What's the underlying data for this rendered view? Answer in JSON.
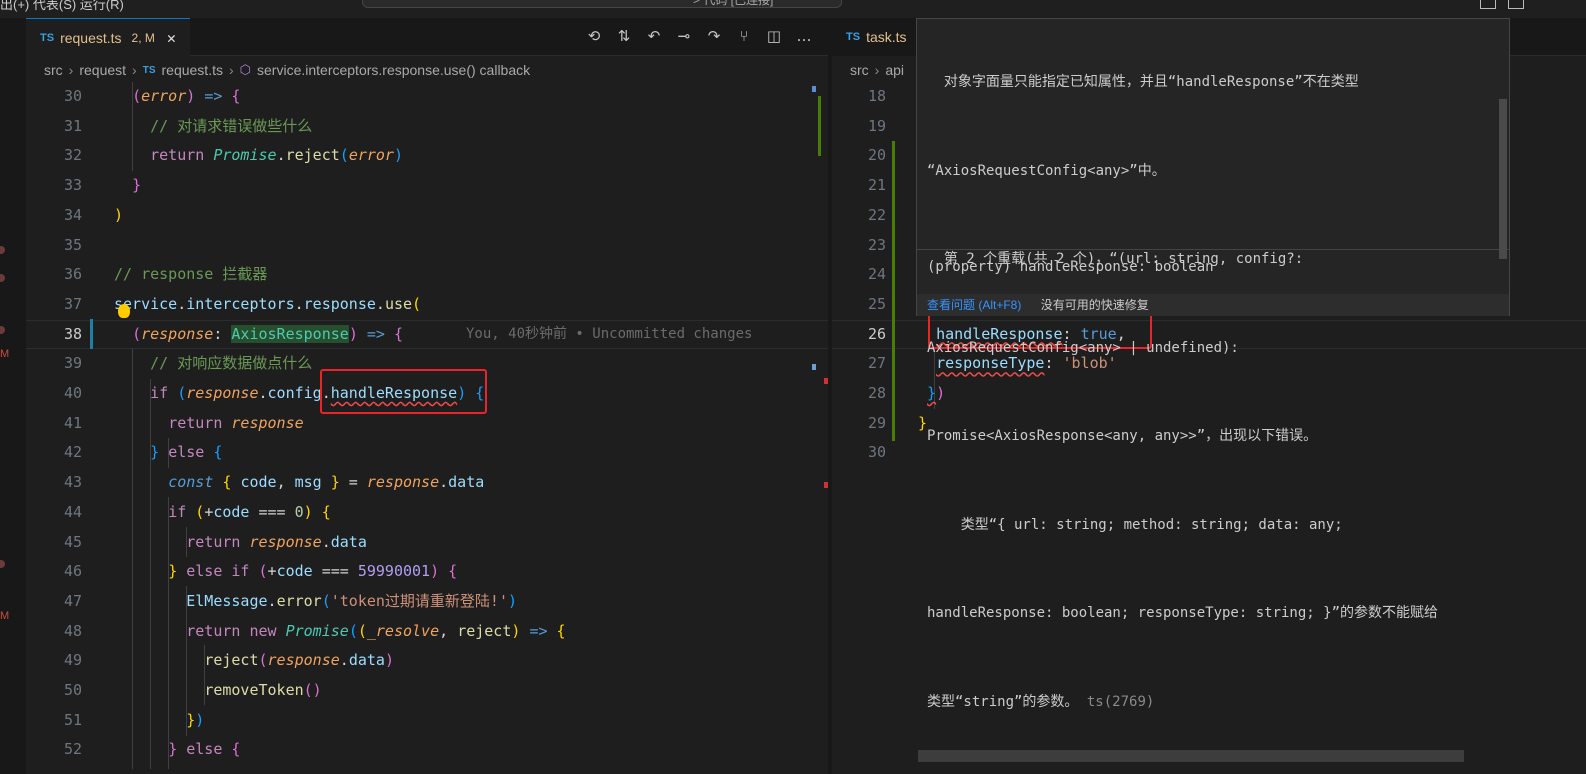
{
  "topbar": {
    "menu_text": "出(+) 代表(S) 运行(R)",
    "search_text": "> 代码 [已连接]"
  },
  "left": {
    "tab": {
      "lang": "TS",
      "filename": "request.ts",
      "badge": "2, M",
      "close": "✕"
    },
    "breadcrumb": [
      "src",
      "request",
      "request.ts",
      "service.interceptors.response.use() callback"
    ],
    "breadcrumb_lang": "TS",
    "toolbar_icons": [
      "history-icon",
      "git-compare-icon",
      "go-back-icon",
      "git-commit-icon",
      "go-forward-icon",
      "source-control-icon",
      "split-editor-icon",
      "more-actions-icon"
    ],
    "blame": "You, 40秒钟前 • Uncommitted changes",
    "line_numbers": [
      "30",
      "31",
      "32",
      "33",
      "34",
      "35",
      "36",
      "37",
      "38",
      "39",
      "40",
      "41",
      "42",
      "43",
      "44",
      "45",
      "46",
      "47",
      "48",
      "49",
      "50",
      "51",
      "52"
    ],
    "l31": "// 对请求错误做些什么",
    "l36": "// response 拦截器",
    "l39": "// 对响应数据做点什么",
    "num_zero": "0",
    "num_big": "59990001",
    "token_msg": "'token过期请重新登陆!'"
  },
  "right": {
    "tab": {
      "lang": "TS",
      "filename": "task.ts"
    },
    "breadcrumb": [
      "src",
      "api"
    ],
    "line_numbers": [
      "18",
      "19",
      "20",
      "21",
      "22",
      "23",
      "24",
      "25",
      "26",
      "27",
      "28",
      "29",
      "30"
    ],
    "l26_key": "handleResponse",
    "l26_val": "true",
    "l27_key": "responseType",
    "l27_val": "'blob'"
  },
  "hover": {
    "line1": "  对象字面量只能指定已知属性，并且“handleResponse”不在类型",
    "line2": "“AxiosRequestConfig<any>”中。",
    "line3": "  第 2 个重载(共 2 个)，“(url: string, config?:",
    "line4": "AxiosRequestConfig<any> | undefined):",
    "line5": "Promise<AxiosResponse<any, any>>”，出现以下错误。",
    "line6": "    类型“{ url: string; method: string; data: any;",
    "line7": "handleResponse: boolean; responseType: string; }”的参数不能赋给",
    "line8": "类型“string”的参数。",
    "ts_code": "ts(2769)",
    "property": "(property) handleResponse: boolean",
    "view_problem": "查看问题 (Alt+F8)",
    "no_fix": "没有可用的快速修复"
  },
  "colors": {
    "accent": "#0078d4",
    "error": "#f14c4c",
    "highlight_box": "#e8252b",
    "git_added": "#487e02"
  }
}
